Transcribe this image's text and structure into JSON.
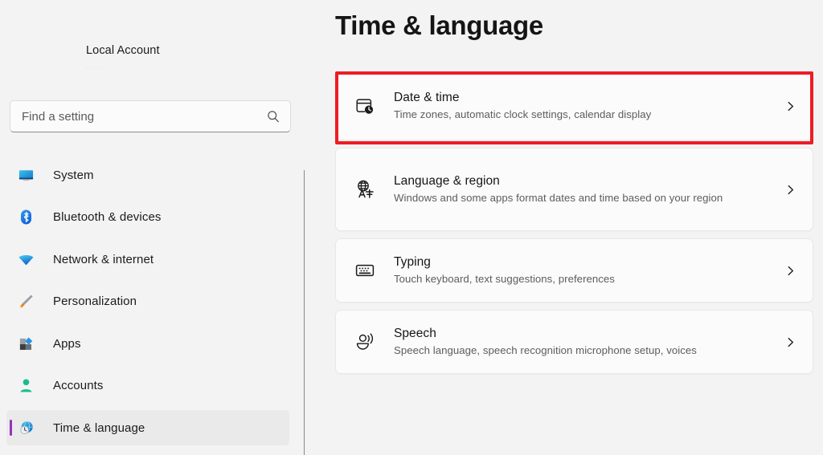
{
  "sidebar": {
    "account": {
      "name": "Local Account",
      "sub": "· ·  ·"
    },
    "search": {
      "placeholder": "Find a setting",
      "value": "",
      "icon": "search-icon"
    },
    "items": [
      {
        "label": "System",
        "icon": "monitor-icon",
        "selected": false
      },
      {
        "label": "Bluetooth & devices",
        "icon": "bluetooth-icon",
        "selected": false
      },
      {
        "label": "Network & internet",
        "icon": "wifi-icon",
        "selected": false
      },
      {
        "label": "Personalization",
        "icon": "paintbrush-icon",
        "selected": false
      },
      {
        "label": "Apps",
        "icon": "apps-icon",
        "selected": false
      },
      {
        "label": "Accounts",
        "icon": "person-icon",
        "selected": false
      },
      {
        "label": "Time & language",
        "icon": "clock-globe-icon",
        "selected": true
      }
    ],
    "selection_accent_color": "#9333bb"
  },
  "main": {
    "title": "Time & language",
    "cards": [
      {
        "title": "Date & time",
        "desc": "Time zones, automatic clock settings, calendar display",
        "icon": "calendar-clock-icon",
        "chevron": "chevron-right-icon",
        "highlighted": true
      },
      {
        "title": "Language & region",
        "desc": "Windows and some apps format dates and time based on your region",
        "icon": "globe-translate-icon",
        "chevron": "chevron-right-icon",
        "highlighted": false
      },
      {
        "title": "Typing",
        "desc": "Touch keyboard, text suggestions, preferences",
        "icon": "keyboard-icon",
        "chevron": "chevron-right-icon",
        "highlighted": false
      },
      {
        "title": "Speech",
        "desc": "Speech language, speech recognition microphone setup, voices",
        "icon": "speech-icon",
        "chevron": "chevron-right-icon",
        "highlighted": false
      }
    ]
  },
  "annotation": {
    "highlight_color": "#ed1c24",
    "target": "Date & time"
  }
}
